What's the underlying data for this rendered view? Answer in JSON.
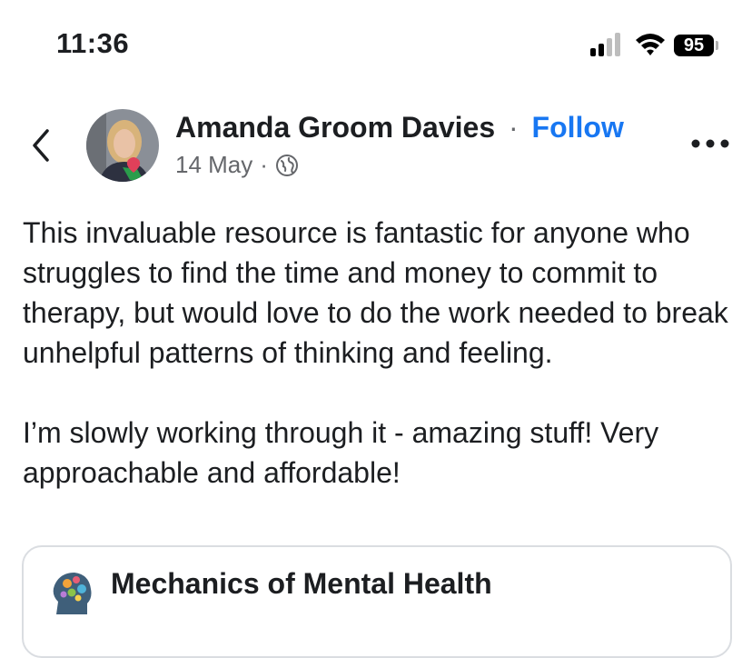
{
  "status_bar": {
    "time": "11:36",
    "battery": "95",
    "icons": [
      "signal-icon",
      "wifi-icon",
      "battery-icon"
    ]
  },
  "header": {
    "back_icon": "chevron-left-icon",
    "author": "Amanda Groom Davies",
    "separator": "·",
    "follow_label": "Follow",
    "date": "14 May",
    "date_separator": "·",
    "privacy_icon": "globe-icon",
    "more_icon": "more-horizontal-icon"
  },
  "post": {
    "paragraphs": [
      "This invaluable resource is fantastic for anyone who struggles to find the time and money to commit to therapy, but would love to do the work needed to break unhelpful patterns of thinking and feeling.",
      "I’m slowly working through it - amazing stuff! Very approachable and affordable!"
    ]
  },
  "link_card": {
    "title": "Mechanics of Mental Health",
    "logo_icon": "head-gears-logo-icon"
  },
  "colors": {
    "accent": "#1877f2",
    "text": "#1c1e21",
    "secondary": "#65676b",
    "card_border": "#dadde1"
  }
}
